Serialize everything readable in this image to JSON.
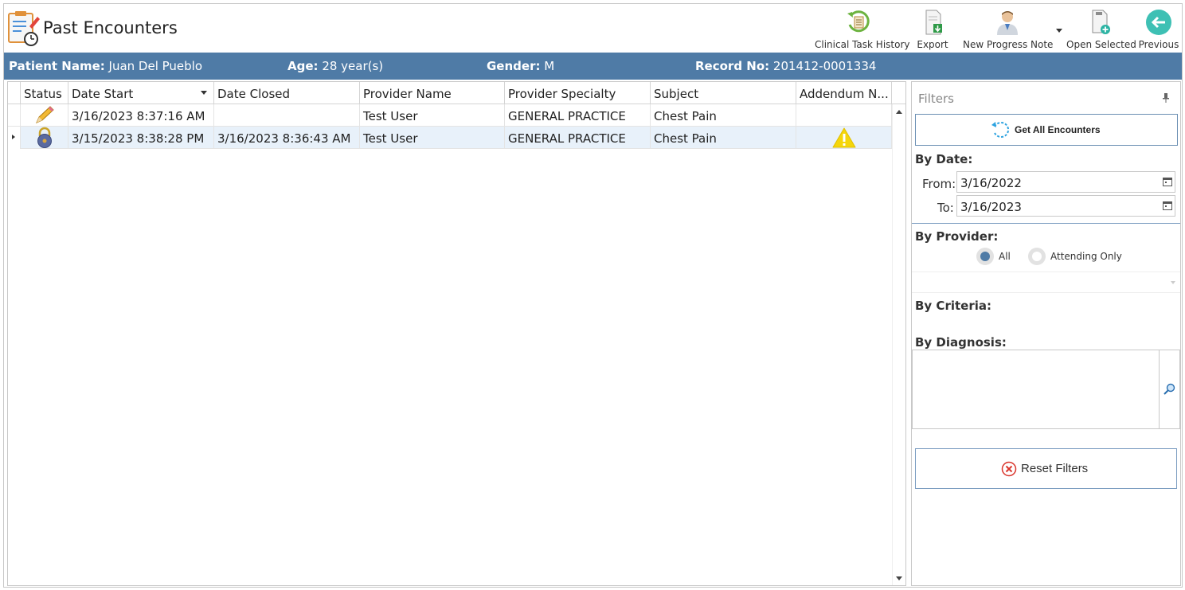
{
  "header": {
    "title": "Past Encounters",
    "toolbar": [
      {
        "label": "Clinical Task History",
        "icon": "clinical-task-history-icon"
      },
      {
        "label": "Export",
        "icon": "export-icon"
      },
      {
        "label": "New Progress Note",
        "icon": "doctor-icon"
      },
      {
        "label": "Open Selected",
        "icon": "open-selected-icon"
      },
      {
        "label": "Previous",
        "icon": "back-arrow-icon"
      }
    ]
  },
  "patient": {
    "name_label": "Patient Name:",
    "name": "Juan Del Pueblo",
    "age_label": "Age:",
    "age": "28 year(s)",
    "gender_label": "Gender:",
    "gender": "M",
    "record_label": "Record No:",
    "record": "201412-0001334"
  },
  "grid": {
    "columns": [
      "Status",
      "Date Start",
      "Date Closed",
      "Provider Name",
      "Provider Specialty",
      "Subject",
      "Addendum N..."
    ],
    "rows": [
      {
        "status": "pencil-icon",
        "date_start": "3/16/2023 8:37:16 AM",
        "date_closed": "",
        "provider": "Test User",
        "specialty": "GENERAL PRACTICE",
        "subject": "Chest Pain",
        "addendum": ""
      },
      {
        "status": "lock-icon",
        "date_start": "3/15/2023 8:38:28 PM",
        "date_closed": "3/16/2023 8:36:43 AM",
        "provider": "Test User",
        "specialty": "GENERAL PRACTICE",
        "subject": "Chest Pain",
        "addendum": "warning-icon"
      }
    ]
  },
  "filters": {
    "title": "Filters",
    "get_all": "Get All Encounters",
    "by_date": "By Date:",
    "from_label": "From:",
    "from_value": "3/16/2022",
    "to_label": "To:",
    "to_value": "3/16/2023",
    "by_provider": "By Provider:",
    "radio_all": "All",
    "radio_attending": "Attending Only",
    "by_criteria": "By Criteria:",
    "by_diagnosis": "By Diagnosis:",
    "reset": "Reset Filters"
  },
  "colors": {
    "accent": "#4f7ba6",
    "selected_row": "#e8f1fa",
    "warning": "#f5d60a",
    "reset_icon": "#d9342b",
    "refresh_icon": "#2ea3e0"
  }
}
